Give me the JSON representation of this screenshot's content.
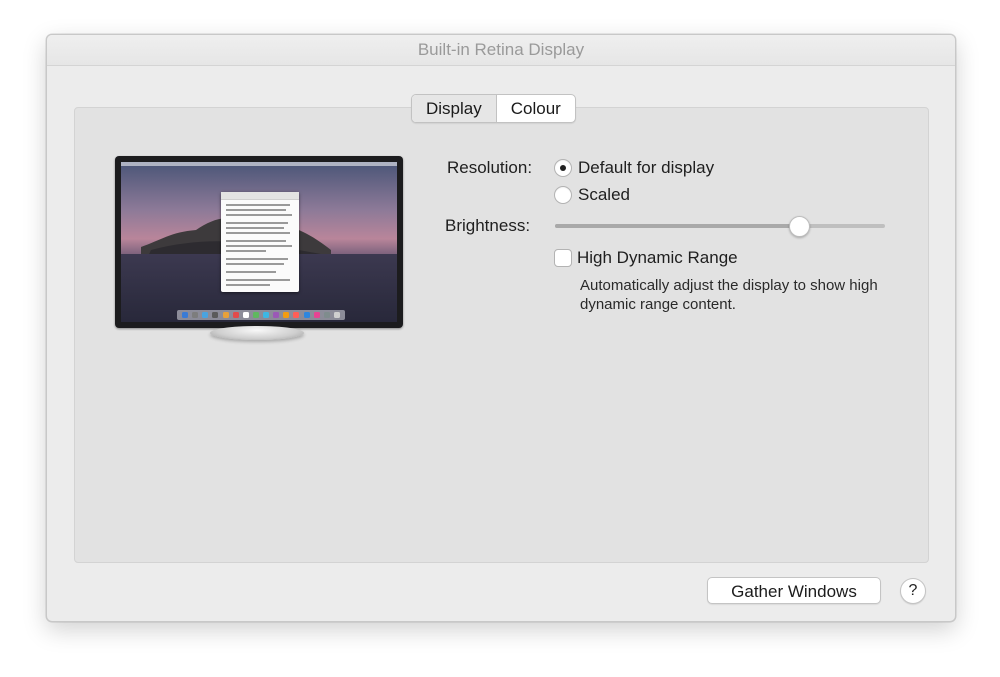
{
  "window": {
    "title": "Built-in Retina Display"
  },
  "tabs": [
    {
      "label": "Display",
      "selected": true
    },
    {
      "label": "Colour",
      "selected": false
    }
  ],
  "resolution": {
    "label": "Resolution:",
    "options": [
      {
        "label": "Default for display",
        "selected": true
      },
      {
        "label": "Scaled",
        "selected": false
      }
    ]
  },
  "brightness": {
    "label": "Brightness:",
    "level": 0.74
  },
  "hdr": {
    "label": "High Dynamic Range",
    "checked": false,
    "description": "Automatically adjust the display to show high dynamic range content."
  },
  "footer": {
    "gather_label": "Gather Windows",
    "help_label": "?"
  },
  "icons": {
    "help": "help-icon",
    "monitor": "monitor-preview-icon"
  }
}
